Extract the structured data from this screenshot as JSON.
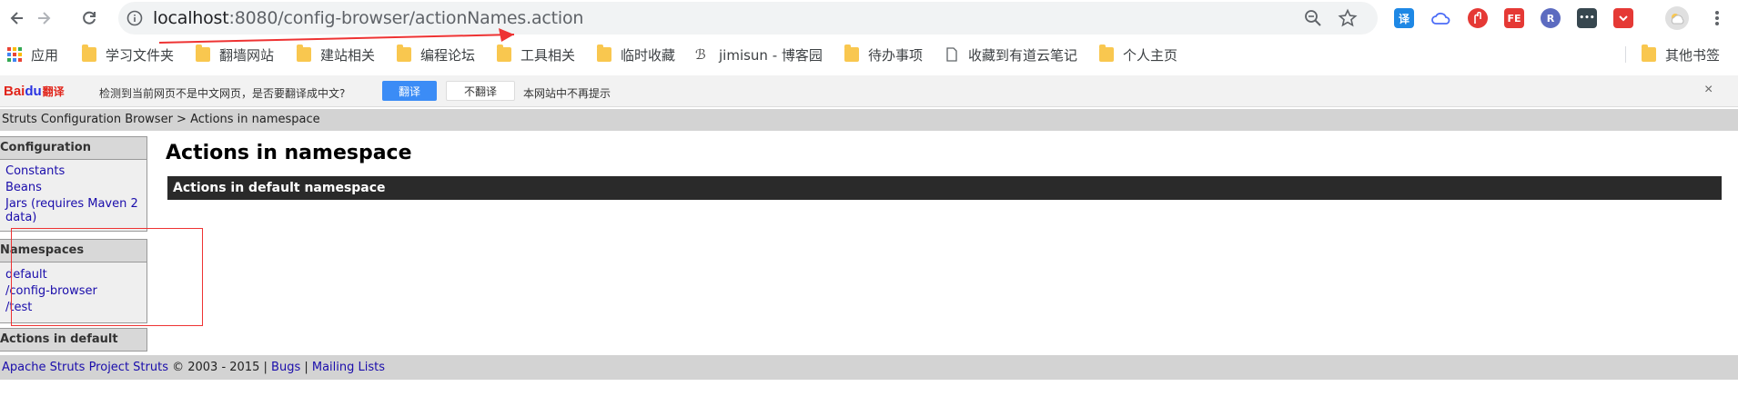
{
  "browser": {
    "url_host": "localhost",
    "url_port_path": ":8080/config-browser/actionNames.action",
    "extensions": [
      {
        "name": "translate-ext-icon",
        "label": "译",
        "color": "#1e88e5"
      },
      {
        "name": "cloud-ext-icon",
        "label": "",
        "color": "#ffffff"
      },
      {
        "name": "shield-ext-icon",
        "label": "",
        "color": "#e53935"
      },
      {
        "name": "fe-ext-icon",
        "label": "FE",
        "color": "#e53935"
      },
      {
        "name": "r-ext-icon",
        "label": "R",
        "color": "#5c6bc0"
      },
      {
        "name": "dots-ext-icon",
        "label": "•••",
        "color": "#37474f"
      },
      {
        "name": "pocket-ext-icon",
        "label": "",
        "color": "#e53935"
      }
    ]
  },
  "bookmarks": {
    "apps": "应用",
    "items": [
      "学习文件夹",
      "翻墙网站",
      "建站相关",
      "编程论坛",
      "工具相关",
      "临时收藏",
      "jimisun - 博客园",
      "待办事项",
      "收藏到有道云笔记",
      "个人主页"
    ],
    "other": "其他书签"
  },
  "translate_bar": {
    "logo_a": "Bai",
    "logo_paw": "du",
    "logo_b": "翻译",
    "message": "检测到当前网页不是中文网页，是否要翻译成中文?",
    "translate_button": "翻译",
    "no_translate_button": "不翻译",
    "never_text": "本网站中不再提示",
    "close": "×"
  },
  "page": {
    "breadcrumb": "Struts Configuration Browser > Actions in namespace",
    "sidebar": {
      "config_header": "Configuration",
      "config_links": [
        "Constants",
        "Beans",
        "Jars (requires Maven 2 data)"
      ],
      "namespaces_header": "Namespaces",
      "namespace_links": [
        "default",
        "/config-browser",
        "/test"
      ],
      "actions_header": "Actions in default"
    },
    "title": "Actions in namespace",
    "namespace_bar": "Actions in default namespace",
    "footer": {
      "project_link": "Apache Struts Project Struts",
      "copyright": " © 2003 - 2015 | ",
      "bugs_link": "Bugs",
      "sep": " | ",
      "mailing_link": "Mailing Lists"
    }
  }
}
